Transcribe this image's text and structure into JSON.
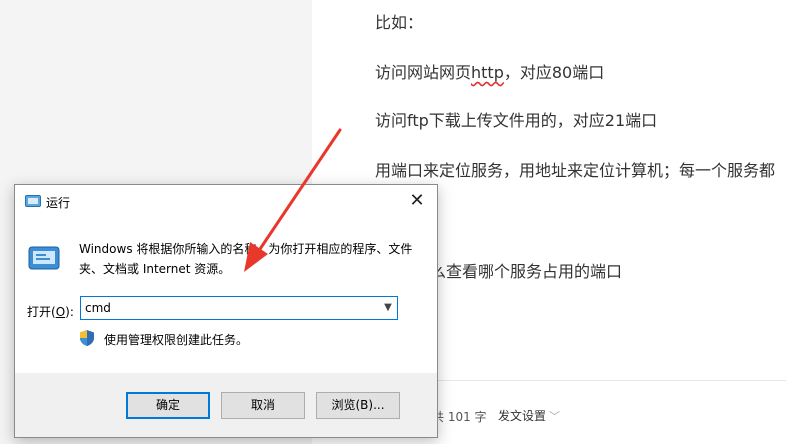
{
  "document": {
    "lines": [
      "比如：",
      "访问网站网页",
      "http",
      "，对应80端口",
      "访问ftp下载上传文件用的，对应21端口",
      "用端口来定位服务，用地址来定位计算机；每一个服务都",
      "么查看哪个服务占用的端口"
    ]
  },
  "statusbar": {
    "char_count": "共 101 字",
    "publish_settings": "发文设置"
  },
  "run_dialog": {
    "title": "运行",
    "description": "Windows 将根据你所输入的名称，为你打开相应的程序、文件夹、文档或 Internet 资源。",
    "open_label": "打开(",
    "open_label_key": "O",
    "open_label_end": "):",
    "command_value": "cmd",
    "admin_note": "使用管理权限创建此任务。",
    "buttons": {
      "ok": "确定",
      "cancel": "取消",
      "browse": "浏览(B)..."
    },
    "close_glyph": "✕"
  },
  "annotation": {
    "arrow_color": "#e8382c"
  },
  "icons": [
    "run-app-icon",
    "run-program-icon",
    "uac-shield-icon",
    "close-icon",
    "chevron-down-icon",
    "red-arrow-annotation"
  ]
}
